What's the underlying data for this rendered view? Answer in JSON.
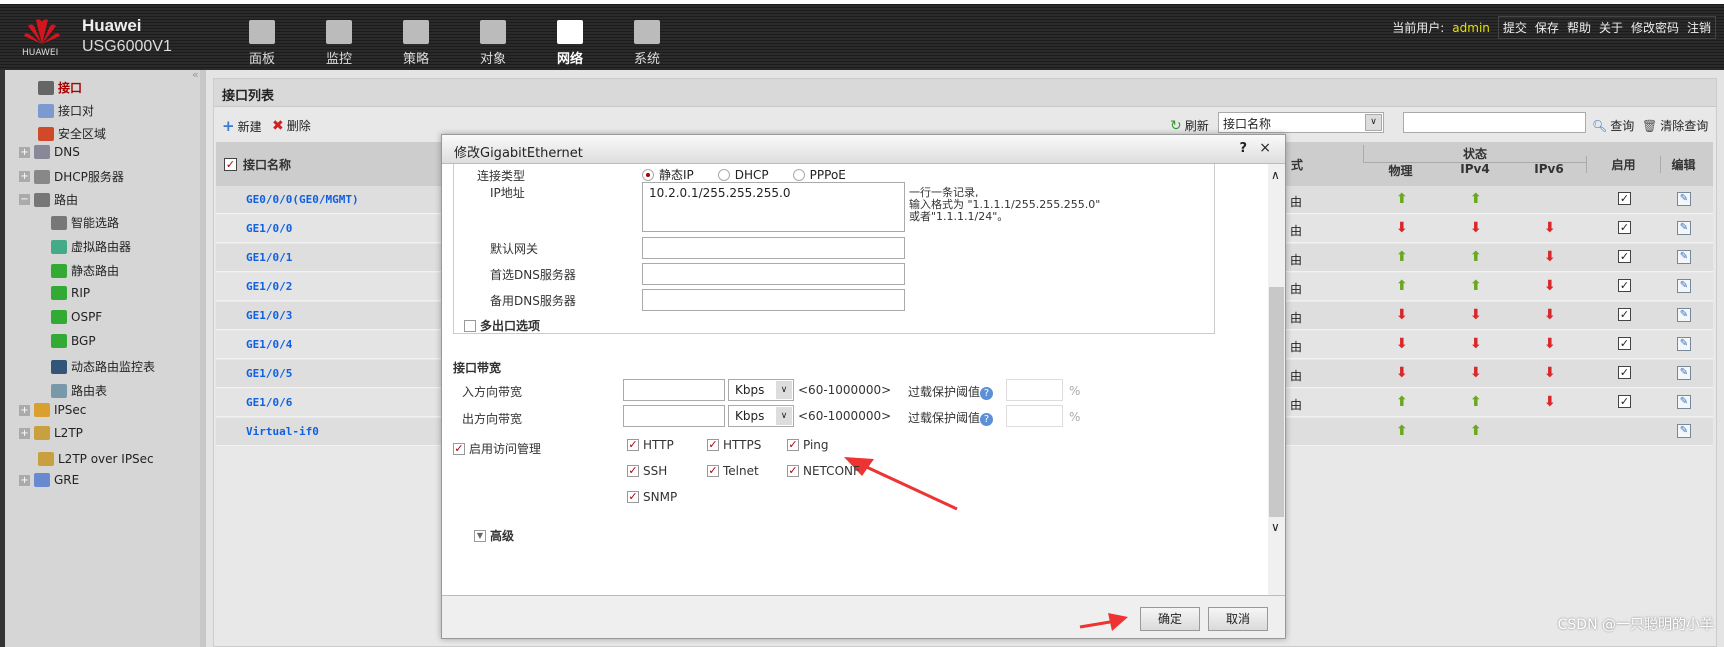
{
  "header": {
    "brand": "Huawei",
    "model": "USG6000V1",
    "logo_text": "HUAWEI",
    "nav": [
      {
        "label": "面板",
        "icon": "dashboard-icon"
      },
      {
        "label": "监控",
        "icon": "monitor-icon"
      },
      {
        "label": "策略",
        "icon": "policy-icon"
      },
      {
        "label": "对象",
        "icon": "object-icon"
      },
      {
        "label": "网络",
        "icon": "network-icon",
        "active": true
      },
      {
        "label": "系统",
        "icon": "system-icon"
      }
    ],
    "user_label": "当前用户:",
    "user": "admin",
    "actions": [
      "提交",
      "保存",
      "帮助",
      "关于",
      "修改密码",
      "注销"
    ]
  },
  "sidebar": {
    "items": [
      "接口",
      "接口对",
      "安全区域",
      "DNS",
      "DHCP服务器",
      "路由",
      "智能选路",
      "虚拟路由器",
      "静态路由",
      "RIP",
      "OSPF",
      "BGP",
      "动态路由监控表",
      "路由表",
      "IPSec",
      "L2TP",
      "L2TP over IPSec",
      "GRE"
    ]
  },
  "panel": {
    "title": "接口列表",
    "new": "新建",
    "delete": "删除",
    "refresh": "刷新",
    "search_field": "接口名称",
    "search_value": "",
    "query": "查询",
    "clear_query": "清除查询",
    "columns": {
      "name": "接口名称",
      "mode": "式",
      "status": "状态",
      "phys": "物理",
      "ipv4": "IPv4",
      "ipv6": "IPv6",
      "enable": "启用",
      "edit": "编辑"
    },
    "rows": [
      {
        "name": "GE0/0/0(GE0/MGMT)",
        "mode": "由",
        "phys": "up",
        "ipv4": "up",
        "ipv6": "",
        "enabled": true
      },
      {
        "name": "GE1/0/0",
        "mode": "由",
        "phys": "down",
        "ipv4": "down",
        "ipv6": "down",
        "enabled": true
      },
      {
        "name": "GE1/0/1",
        "mode": "由",
        "phys": "up",
        "ipv4": "up",
        "ipv6": "down",
        "enabled": true
      },
      {
        "name": "GE1/0/2",
        "mode": "由",
        "phys": "up",
        "ipv4": "up",
        "ipv6": "down",
        "enabled": true
      },
      {
        "name": "GE1/0/3",
        "mode": "由",
        "phys": "down",
        "ipv4": "down",
        "ipv6": "down",
        "enabled": true
      },
      {
        "name": "GE1/0/4",
        "mode": "由",
        "phys": "down",
        "ipv4": "down",
        "ipv6": "down",
        "enabled": true
      },
      {
        "name": "GE1/0/5",
        "mode": "由",
        "phys": "down",
        "ipv4": "down",
        "ipv6": "down",
        "enabled": true
      },
      {
        "name": "GE1/0/6",
        "mode": "由",
        "phys": "up",
        "ipv4": "up",
        "ipv6": "down",
        "enabled": true
      },
      {
        "name": "Virtual-if0",
        "mode": "",
        "phys": "up",
        "ipv4": "up",
        "ipv6": "",
        "enabled": null
      }
    ]
  },
  "dialog": {
    "title": "修改GigabitEthernet",
    "help": "?",
    "close": "×",
    "conn_type_label": "连接类型",
    "conn_types": [
      "静态IP",
      "DHCP",
      "PPPoE"
    ],
    "conn_type_selected": "静态IP",
    "ip_label": "IP地址",
    "ip_value": "10.2.0.1/255.255.255.0",
    "ip_hint": [
      "一行一条记录,",
      "输入格式为 \"1.1.1.1/255.255.255.0\"",
      "或者\"1.1.1.1/24\"。"
    ],
    "gateway_label": "默认网关",
    "dns1_label": "首选DNS服务器",
    "dns2_label": "备用DNS服务器",
    "multi_exit": "多出口选项",
    "bw_section": "接口带宽",
    "in_bw_label": "入方向带宽",
    "out_bw_label": "出方向带宽",
    "unit": "Kbps",
    "range": "<60-1000000>",
    "overload_label": "过载保护阈值",
    "percent": "%",
    "access_label": "启用访问管理",
    "access_enabled": true,
    "services": [
      {
        "name": "HTTP",
        "checked": true
      },
      {
        "name": "HTTPS",
        "checked": true
      },
      {
        "name": "Ping",
        "checked": true
      },
      {
        "name": "SSH",
        "checked": true
      },
      {
        "name": "Telnet",
        "checked": true
      },
      {
        "name": "NETCONF",
        "checked": true
      },
      {
        "name": "SNMP",
        "checked": true
      }
    ],
    "advanced": "高级",
    "ok": "确定",
    "cancel": "取消"
  },
  "watermark": "CSDN @一只聪明的小羊",
  "colors": {
    "accent": "#aa0000",
    "up": "#6aa820",
    "down": "#d8282a",
    "link": "#1060e0",
    "annotation_arrow": "#ee3333"
  }
}
